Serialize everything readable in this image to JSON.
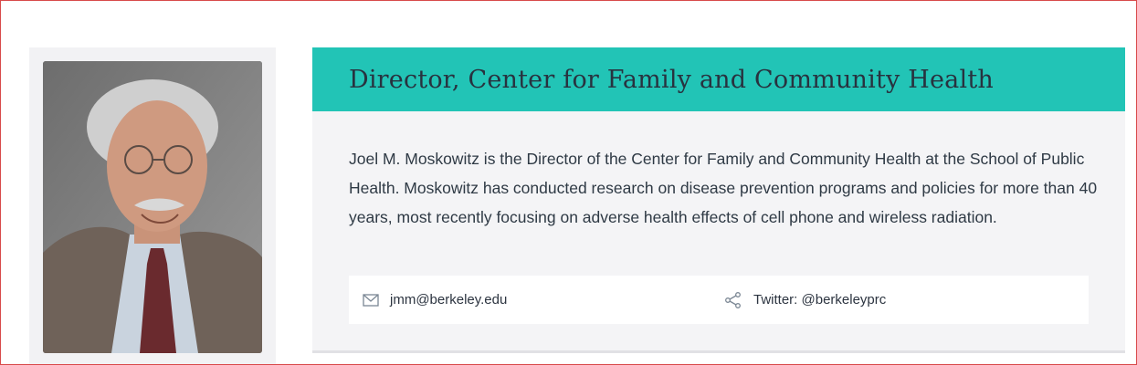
{
  "profile": {
    "title": "Director, Center for Family and Community Health",
    "bio": "Joel M. Moskowitz is the Director of the Center for Family and Community Health at the School of Public Health. Moskowitz has conducted research on disease prevention programs and policies for more than 40 years, most recently focusing on adverse health effects of cell phone and wireless radiation.",
    "contact": {
      "email": "jmm@berkeley.edu",
      "email_icon": "envelope-icon",
      "twitter": "Twitter: @berkeleyprc",
      "twitter_icon": "share-icon"
    }
  },
  "colors": {
    "accent": "#22c4b6",
    "title_text": "#28323f",
    "card_bg": "#f4f4f6"
  }
}
